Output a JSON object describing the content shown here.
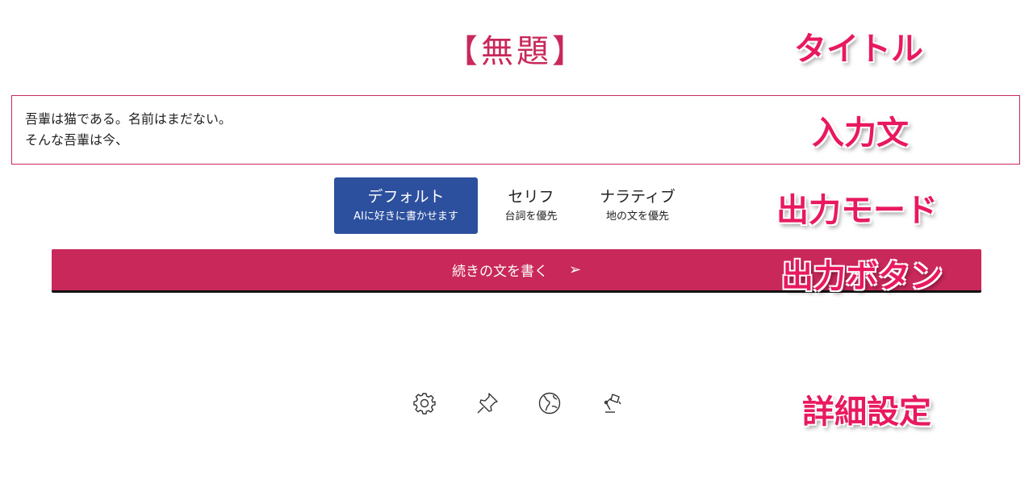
{
  "title": "【無題】",
  "input": {
    "lines": [
      "吾輩は猫である。名前はまだない。",
      "そんな吾輩は今、"
    ]
  },
  "modes": [
    {
      "label": "デフォルト",
      "sub": "AIに好きに書かせます",
      "active": true
    },
    {
      "label": "セリフ",
      "sub": "台詞を優先",
      "active": false
    },
    {
      "label": "ナラティブ",
      "sub": "地の文を優先",
      "active": false
    }
  ],
  "output_button": {
    "label": "続きの文を書く",
    "arrow": "➢"
  },
  "settings_icons": [
    "gear-icon",
    "pushpin-icon",
    "globe-icon",
    "desk-lamp-icon"
  ],
  "annotations": {
    "title": "タイトル",
    "input": "入力文",
    "mode": "出力モード",
    "output": "出力ボタン",
    "detail": "詳細設定"
  },
  "colors": {
    "accent": "#c8285a",
    "active_mode": "#2c4f9e",
    "annotation": "#e8195f"
  }
}
